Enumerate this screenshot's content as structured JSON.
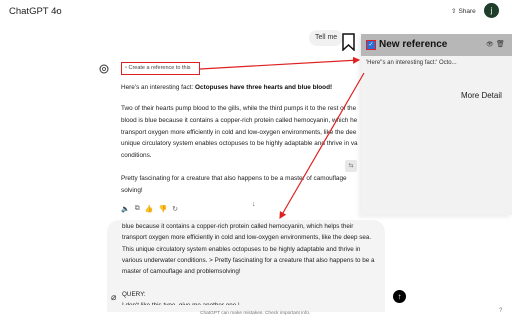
{
  "header": {
    "model_name": "ChatGPT 4o",
    "share_label": "Share",
    "avatar_letter": "j"
  },
  "user_message": "Tell me",
  "assistant": {
    "reference_button": "Create a reference to this",
    "para1_intro": "Here's an interesting fact: ",
    "para1_bold": "Octopuses have three hearts and blue blood!",
    "para2_lines": [
      "Two of their hearts pump blood to the gills, while the third pumps it to the rest of the",
      "blood is blue because it contains a copper-rich protein called hemocyanin, which he",
      "transport oxygen more efficiently in cold and low-oxygen environments, like the dee",
      "unique circulatory system enables octopuses to be highly adaptable and thrive in va",
      "conditions."
    ],
    "para3_lines": [
      "Pretty fascinating for a creature that also happens to be a master of camouflage",
      "solving!"
    ]
  },
  "composer": {
    "text": "blue because it contains a copper-rich protein called hemocyanin, which helps their\ntransport oxygen more efficiently in cold and low-oxygen environments, like the deep sea.\nThis unique circulatory system enables octopuses to be highly adaptable and thrive in\nvarious underwater conditions. > Pretty fascinating for a creature that also happens to be a\nmaster of camouflage and problemsolving!\n\nQUERY:\nI don't like this type, give me another one.|"
  },
  "footer": {
    "note": "ChatGPT can make mistakes. Check important info.",
    "help": "?"
  },
  "reference_panel": {
    "title": "New reference",
    "quote": "'Here''s an interesting fact:' Octo...",
    "more_label": "More Detail"
  },
  "colors": {
    "highlight_red": "#e02020",
    "panel_header": "#b7b7b7",
    "checkbox_blue": "#2a6fd8"
  }
}
